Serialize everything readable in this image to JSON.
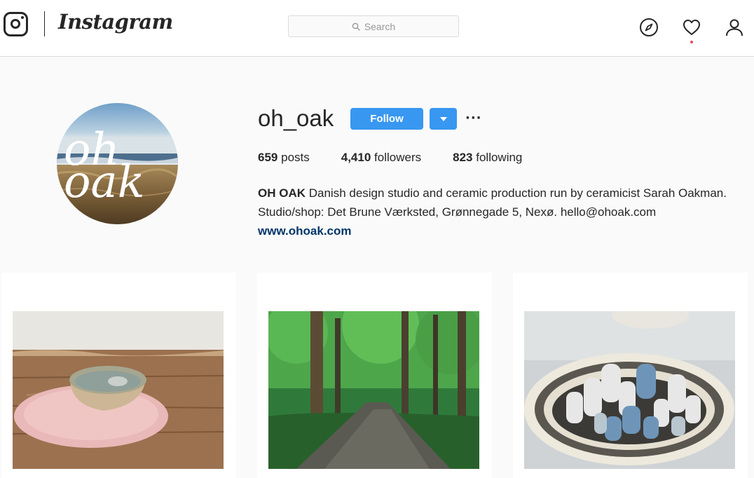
{
  "header": {
    "wordmark": "Instagram",
    "search_placeholder": "Search",
    "icons": [
      "instagram-camera-icon",
      "search-icon",
      "compass-icon",
      "heart-icon",
      "user-icon"
    ]
  },
  "profile": {
    "username": "oh_oak",
    "follow_label": "Follow",
    "more_label": "···",
    "stats": {
      "posts_count": "659",
      "posts_label": "posts",
      "followers_count": "4,410",
      "followers_label": "followers",
      "following_count": "823",
      "following_label": "following"
    },
    "bio_name": "OH OAK",
    "bio_text": "Danish design studio and ceramic production run by ceramicist Sarah Oakman. Studio/shop: Det Brune Værksted, Grønnegade 5, Nexø. hello@ohoak.com",
    "website": "www.ohoak.com",
    "avatar_text_line1": "oh",
    "avatar_text_line2": "oak"
  },
  "colors": {
    "accent": "#3897f0",
    "link": "#003569",
    "notification": "#ed4956",
    "background": "#fafafa",
    "border": "#dbdbdb"
  }
}
